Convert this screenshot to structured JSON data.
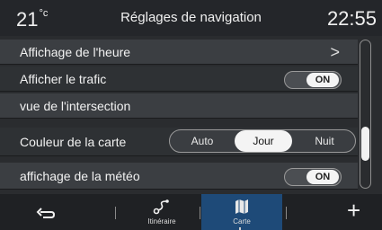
{
  "header": {
    "temperature": "21",
    "temperature_unit": "°c",
    "title": "Réglages de navigation",
    "time": "22:55"
  },
  "settings": {
    "row1": {
      "label": "Affichage de l'heure",
      "chevron": ">"
    },
    "row2": {
      "label": "Afficher le trafic",
      "toggle": "ON"
    },
    "row3": {
      "label": "vue de l'intersection"
    },
    "row4": {
      "label": "Couleur de la carte",
      "options": [
        "Auto",
        "Jour",
        "Nuit"
      ],
      "selected": "Jour"
    },
    "row5": {
      "label": "affichage de la météo",
      "toggle": "ON"
    }
  },
  "bottom_nav": {
    "itineraire": "Itinéraire",
    "carte": "Carte",
    "active": "Carte",
    "plus": "+"
  },
  "icons": {
    "back": "back-arrow-icon",
    "itineraire": "route-icon",
    "carte": "map-icon",
    "add": "plus-icon"
  }
}
